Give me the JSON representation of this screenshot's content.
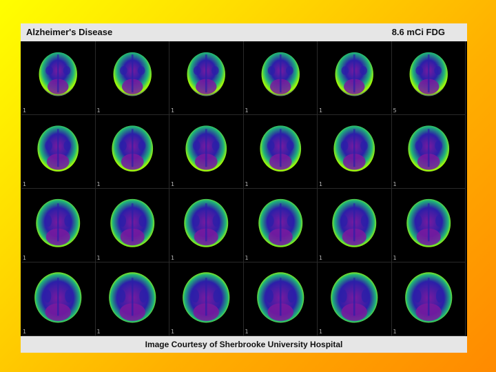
{
  "title": "Alzheimer's Disease",
  "dose": "8.6 mCi FDG",
  "credit": "Image Courtesy of  Sherbrooke University Hospital",
  "scan": {
    "rows": 4,
    "cols": 6,
    "slice_labels": [
      [
        "1",
        "1",
        "1",
        "1",
        "1",
        "5"
      ],
      [
        "1",
        "1",
        "1",
        "1",
        "1",
        "1"
      ],
      [
        "1",
        "1",
        "1",
        "1",
        "1",
        "1"
      ],
      [
        "1",
        "1",
        "1",
        "1",
        "1",
        "1"
      ]
    ]
  },
  "colors": {
    "background_top": "#ffff00",
    "background_bottom": "#ff8a00",
    "uptake_high": "#a6ff00",
    "uptake_mid": "#1fb37a",
    "uptake_low": "#2b1fa8",
    "uptake_background": "#7a1a9e"
  }
}
